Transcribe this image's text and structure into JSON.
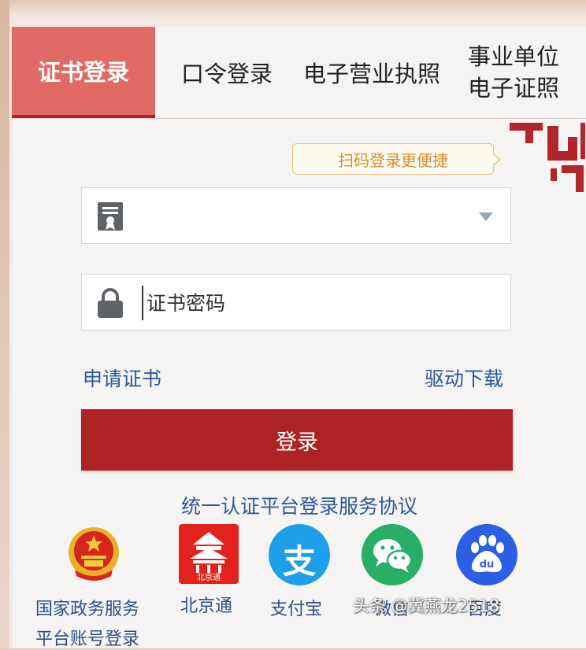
{
  "tabs": {
    "cert_login": "证书登录",
    "password_login": "口令登录",
    "e_license": "电子营业执照",
    "institution_line1": "事业单位",
    "institution_line2": "电子证照"
  },
  "qr_tip": "扫码登录更便捷",
  "form": {
    "cert_select_value": "",
    "password_placeholder": "证书密码",
    "apply_cert": "申请证书",
    "driver_download": "驱动下载",
    "login_button": "登录",
    "agreement": "统一认证平台登录服务协议"
  },
  "third_party": {
    "gov_line1": "国家政务服务",
    "gov_line2": "平台账号登录",
    "beijing": "北京通",
    "beijing_badge": "北京通",
    "alipay": "支付宝",
    "alipay_glyph": "支",
    "wechat": "微信",
    "baidu": "百度",
    "baidu_glyph": "du"
  },
  "watermark": "头条 @冀燕龙2518",
  "colors": {
    "accent_red": "#ad2222",
    "tab_active": "#e16a66",
    "link_blue": "#2c5a9a",
    "alipay_blue": "#1ea0e8",
    "wechat_green": "#2aae67",
    "baidu_blue": "#2d5fe5"
  },
  "icons": {
    "cert": "certificate-icon",
    "lock": "lock-icon",
    "select_caret": "triangle-down-icon",
    "qr": "qr-corner-icon"
  }
}
